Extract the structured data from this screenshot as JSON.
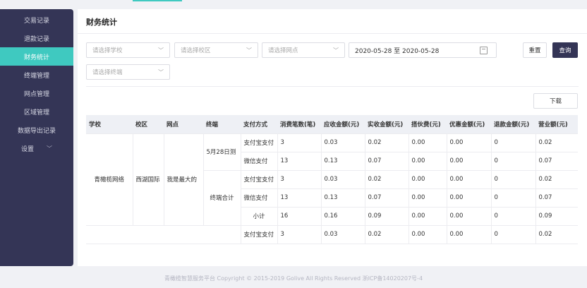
{
  "sidebar": {
    "items": [
      {
        "label": "交易记录"
      },
      {
        "label": "退款记录"
      },
      {
        "label": "财务统计"
      },
      {
        "label": "终端管理"
      },
      {
        "label": "网点管理"
      },
      {
        "label": "区域管理"
      },
      {
        "label": "数据导出记录"
      },
      {
        "label": "设置"
      }
    ],
    "active_index": 2,
    "settings_chevron": "chevron-down-icon"
  },
  "main": {
    "title": "财务统计"
  },
  "filters": {
    "school": "请选择学校",
    "campus": "请选择校区",
    "outlet": "请选择网点",
    "terminal": "请选择终端",
    "date_range": "2020-05-28 至 2020-05-28",
    "reset": "重置",
    "query": "查询",
    "download": "下载"
  },
  "table": {
    "headers": [
      "学校",
      "校区",
      "网点",
      "终端",
      "支付方式",
      "消费笔数(笔)",
      "应收金额(元)",
      "实收金额(元)",
      "搭伙费(元)",
      "优惠金额(元)",
      "退款金额(元)",
      "营业额(元)"
    ],
    "school": "青橄榄网络",
    "campus": "西湖国际",
    "outlet": "我是最大的",
    "terminal_1": "5月28日测",
    "terminal_2": "终端合计",
    "rows": [
      [
        "支付宝支付",
        "3",
        "0.03",
        "0.02",
        "0.00",
        "0.00",
        "0",
        "0.02"
      ],
      [
        "微信支付",
        "13",
        "0.13",
        "0.07",
        "0.00",
        "0.00",
        "0",
        "0.07"
      ],
      [
        "支付宝支付",
        "3",
        "0.03",
        "0.02",
        "0.00",
        "0.00",
        "0",
        "0.02"
      ],
      [
        "微信支付",
        "13",
        "0.13",
        "0.07",
        "0.00",
        "0.00",
        "0",
        "0.07"
      ],
      [
        "小计",
        "16",
        "0.16",
        "0.09",
        "0.00",
        "0.00",
        "0",
        "0.09"
      ],
      [
        "支付宝支付",
        "3",
        "0.03",
        "0.02",
        "0.00",
        "0.00",
        "0",
        "0.02"
      ]
    ]
  },
  "footer": {
    "text": "青橄榄智慧服务平台 Copyright © 2015-2019 Golive All Rights Reserved  浙ICP备14020207号-4"
  },
  "colors": {
    "sidebar_bg": "#343556",
    "accent": "#3fc9c0",
    "primary_button": "#343556"
  }
}
